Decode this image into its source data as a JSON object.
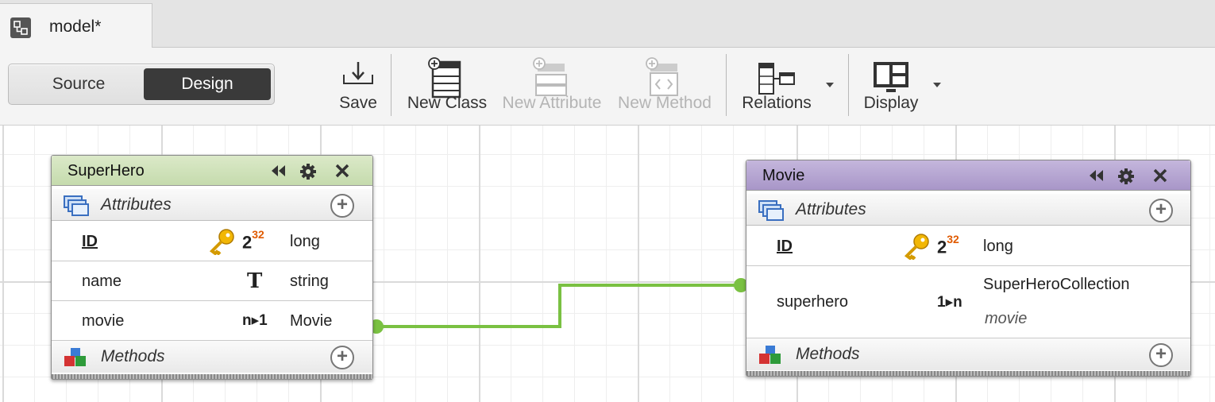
{
  "tab": {
    "label": "model*",
    "icon": "model-diagram-icon"
  },
  "toolbar": {
    "source_label": "Source",
    "design_label": "Design",
    "save_label": "Save",
    "new_class_label": "New Class",
    "new_attribute_label": "New Attribute",
    "new_method_label": "New Method",
    "relations_label": "Relations",
    "display_label": "Display"
  },
  "colors": {
    "superhero_header": "#cfe0b8",
    "movie_header": "#b6a6d2",
    "relation_line": "#7ac142",
    "active_segment": "#3a3a3a"
  },
  "classes": {
    "superhero": {
      "title": "SuperHero",
      "attributes_label": "Attributes",
      "methods_label": "Methods",
      "rows": [
        {
          "name": "ID",
          "type_badge": "2",
          "type_badge_sup": "32",
          "type": "long",
          "icon": "key-icon"
        },
        {
          "name": "name",
          "type_badge": "T",
          "type": "string",
          "icon": "text-type-icon"
        },
        {
          "name": "movie",
          "type_badge": "n▸1",
          "type": "Movie",
          "icon": "many-to-one-icon"
        }
      ]
    },
    "movie": {
      "title": "Movie",
      "attributes_label": "Attributes",
      "methods_label": "Methods",
      "rows": [
        {
          "name": "ID",
          "type_badge": "2",
          "type_badge_sup": "32",
          "type": "long",
          "icon": "key-icon"
        },
        {
          "name": "superhero",
          "type_badge": "1▸n",
          "type": "SuperHeroCollection",
          "type_sub": "movie",
          "icon": "one-to-many-icon"
        }
      ]
    }
  }
}
